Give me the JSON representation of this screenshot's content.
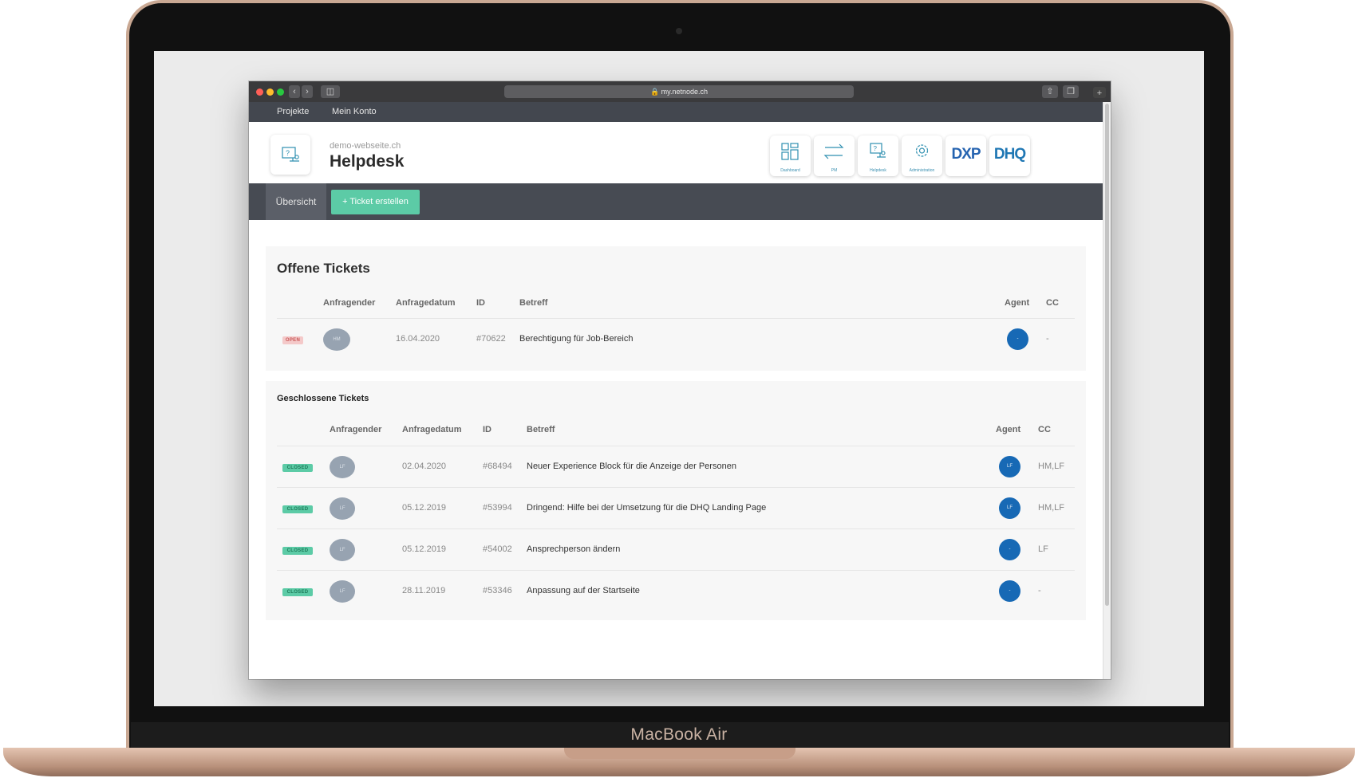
{
  "device": {
    "brand_label": "MacBook Air"
  },
  "browser": {
    "url": "my.netnode.ch"
  },
  "topnav": {
    "projects": "Projekte",
    "account": "Mein Konto"
  },
  "header": {
    "domain": "demo-webseite.ch",
    "title": "Helpdesk",
    "apps": [
      {
        "label": "Dashboard",
        "icon": "dashboard-icon"
      },
      {
        "label": "PM",
        "icon": "transfer-icon"
      },
      {
        "label": "Helpdesk",
        "icon": "helpdesk-icon"
      },
      {
        "label": "Administration",
        "icon": "gear-icon"
      },
      {
        "label": "DXP",
        "icon": "dxp-logo"
      },
      {
        "label": "DHQ",
        "icon": "dhq-logo"
      }
    ]
  },
  "subnav": {
    "overview": "Übersicht",
    "create_ticket": "+ Ticket erstellen"
  },
  "open_tickets": {
    "title": "Offene Tickets",
    "columns": [
      "Anfragender",
      "Anfragedatum",
      "ID",
      "Betreff",
      "Agent",
      "CC"
    ],
    "rows": [
      {
        "status": "OPEN",
        "requester": "HM",
        "date": "16.04.2020",
        "id": "#70622",
        "subject": "Berechtigung für Job-Bereich",
        "agent": "-",
        "cc": "-"
      }
    ]
  },
  "closed_tickets": {
    "title": "Geschlossene Tickets",
    "columns": [
      "Anfragender",
      "Anfragedatum",
      "ID",
      "Betreff",
      "Agent",
      "CC"
    ],
    "rows": [
      {
        "status": "CLOSED",
        "requester": "LF",
        "date": "02.04.2020",
        "id": "#68494",
        "subject": "Neuer Experience Block für die Anzeige der Personen",
        "agent": "LF",
        "cc": "HM,LF"
      },
      {
        "status": "CLOSED",
        "requester": "LF",
        "date": "05.12.2019",
        "id": "#53994",
        "subject": "Dringend: Hilfe bei der Umsetzung für die DHQ Landing Page",
        "agent": "LF",
        "cc": "HM,LF"
      },
      {
        "status": "CLOSED",
        "requester": "LF",
        "date": "05.12.2019",
        "id": "#54002",
        "subject": "Ansprechperson ändern",
        "agent": "-",
        "cc": "LF"
      },
      {
        "status": "CLOSED",
        "requester": "LF",
        "date": "28.11.2019",
        "id": "#53346",
        "subject": "Anpassung auf der Startseite",
        "agent": "-",
        "cc": "-"
      }
    ]
  },
  "colors": {
    "accent": "#5ccba6",
    "agent_blue": "#1769b5",
    "nav_dark": "#474b53",
    "open_badge": "#f4c9c9"
  }
}
